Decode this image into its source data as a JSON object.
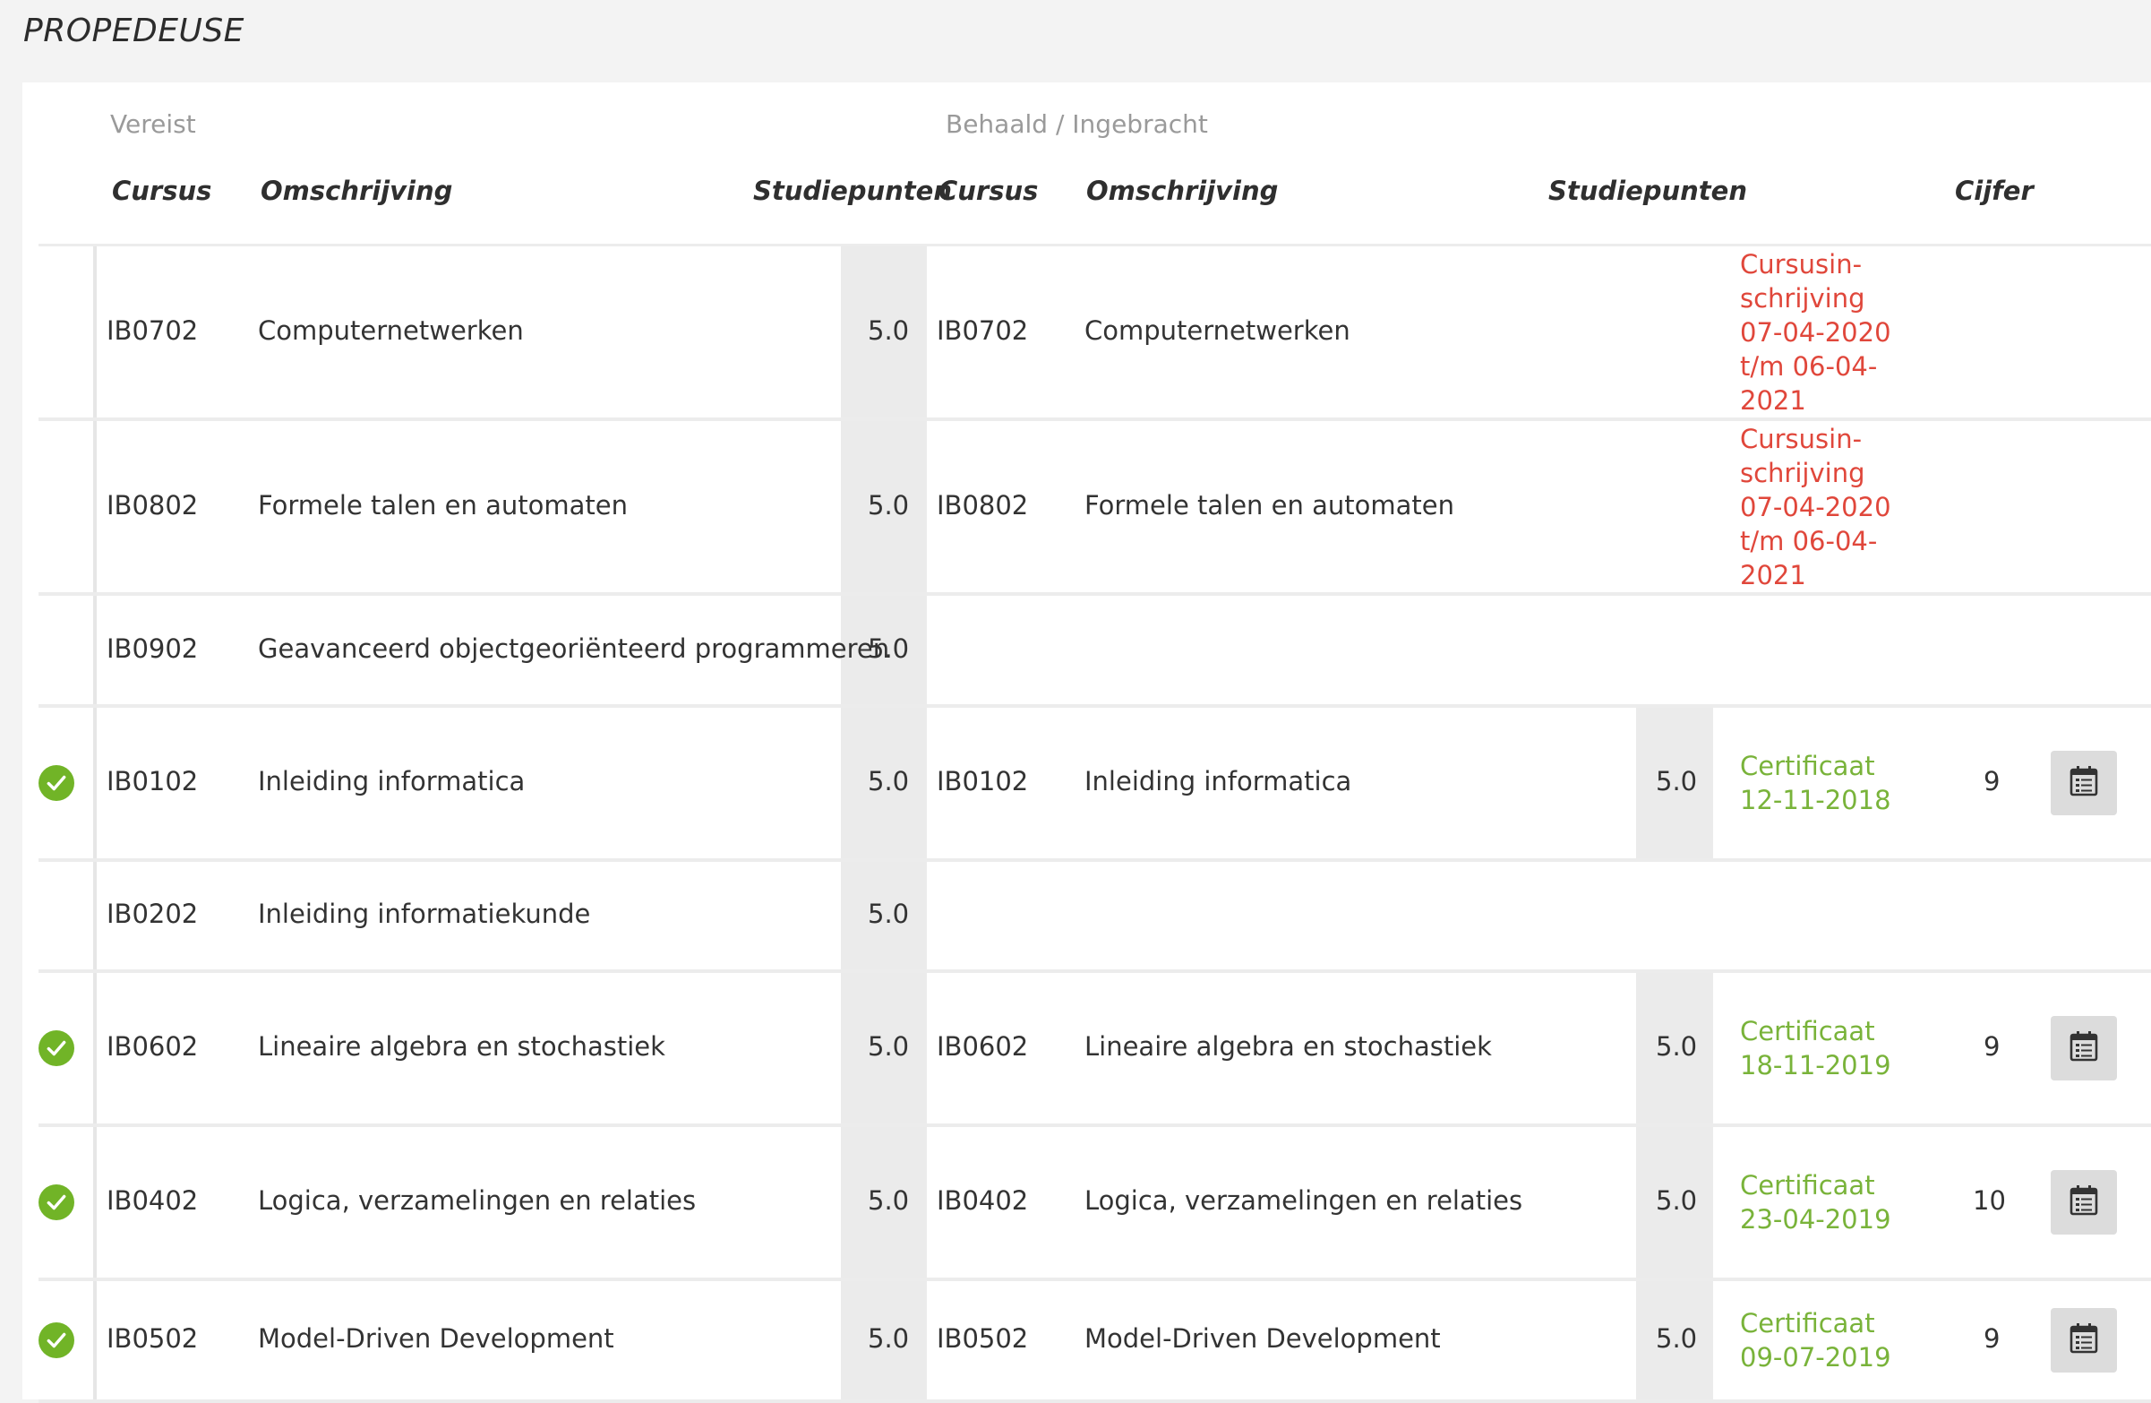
{
  "section_title": "PROPEDEUSE",
  "groups": {
    "required": "Vereist",
    "achieved": "Behaald / Ingebracht"
  },
  "headers": {
    "req_course": "Cursus",
    "req_description": "Omschrijving",
    "req_credits": "Studiepunten",
    "ach_course": "Cursus",
    "ach_description": "Omschrijving",
    "ach_credits": "Studiepunten",
    "grade": "Cijfer"
  },
  "rows": [
    {
      "passed": false,
      "req_code": "IB0702",
      "req_name": "Computernetwerken",
      "req_credits": "5.0",
      "ach_code": "IB0702",
      "ach_name": "Computernetwerken",
      "ach_credits": "",
      "status_lines": [
        "Cursusin-",
        "schrijving",
        "07-04-2020",
        "t/m 06-04-",
        "2021"
      ],
      "status_color": "red",
      "grade": ""
    },
    {
      "passed": false,
      "req_code": "IB0802",
      "req_name": "Formele talen en automaten",
      "req_credits": "5.0",
      "ach_code": "IB0802",
      "ach_name": "Formele talen en automaten",
      "ach_credits": "",
      "status_lines": [
        "Cursusin-",
        "schrijving",
        "07-04-2020",
        "t/m 06-04-",
        "2021"
      ],
      "status_color": "red",
      "grade": ""
    },
    {
      "passed": false,
      "req_code": "IB0902",
      "req_name": "Geavanceerd objectgeoriënteerd programmeren",
      "req_credits": "5.0",
      "ach_code": "",
      "ach_name": "",
      "ach_credits": "",
      "status_lines": [],
      "status_color": "",
      "grade": ""
    },
    {
      "passed": true,
      "req_code": "IB0102",
      "req_name": "Inleiding informatica",
      "req_credits": "5.0",
      "ach_code": "IB0102",
      "ach_name": "Inleiding informatica",
      "ach_credits": "5.0",
      "status_lines": [
        "Certificaat",
        "12-11-2018"
      ],
      "status_color": "green",
      "grade": "9"
    },
    {
      "passed": false,
      "req_code": "IB0202",
      "req_name": "Inleiding informatiekunde",
      "req_credits": "5.0",
      "ach_code": "",
      "ach_name": "",
      "ach_credits": "",
      "status_lines": [],
      "status_color": "",
      "grade": ""
    },
    {
      "passed": true,
      "req_code": "IB0602",
      "req_name": "Lineaire algebra en stochastiek",
      "req_credits": "5.0",
      "ach_code": "IB0602",
      "ach_name": "Lineaire algebra en stochastiek",
      "ach_credits": "5.0",
      "status_lines": [
        "Certificaat",
        "18-11-2019"
      ],
      "status_color": "green",
      "grade": "9"
    },
    {
      "passed": true,
      "req_code": "IB0402",
      "req_name": "Logica, verzamelingen en relaties",
      "req_credits": "5.0",
      "ach_code": "IB0402",
      "ach_name": "Logica, verzamelingen en relaties",
      "ach_credits": "5.0",
      "status_lines": [
        "Certificaat",
        "23-04-2019"
      ],
      "status_color": "green",
      "grade": "10"
    },
    {
      "passed": true,
      "req_code": "IB0502",
      "req_name": "Model-Driven Development",
      "req_credits": "5.0",
      "ach_code": "IB0502",
      "ach_name": "Model-Driven Development",
      "ach_credits": "5.0",
      "status_lines": [
        "Certificaat",
        "09-07-2019"
      ],
      "status_color": "green",
      "grade": "9"
    }
  ],
  "colors": {
    "passed_green": "#71b427",
    "status_red": "#e0473b",
    "status_green": "#79b33a"
  },
  "icons": {
    "passed": "check-circle-icon",
    "details": "calendar-list-icon"
  }
}
